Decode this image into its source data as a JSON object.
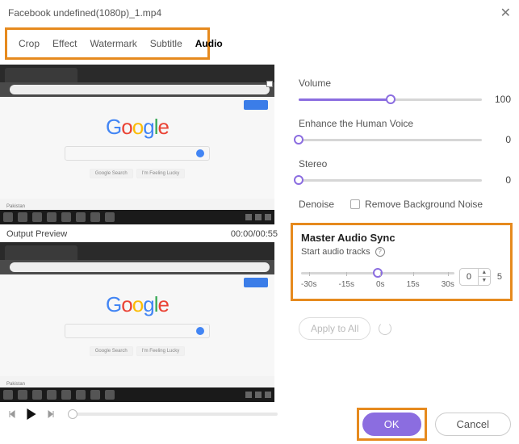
{
  "titlebar": {
    "filename": "Facebook undefined(1080p)_1.mp4"
  },
  "tabs": {
    "crop": "Crop",
    "effect": "Effect",
    "watermark": "Watermark",
    "subtitle": "Subtitle",
    "audio": "Audio",
    "active": "Audio"
  },
  "preview": {
    "output_label": "Output Preview",
    "timecode": "00:00/00:55",
    "google_btn1": "Google Search",
    "google_btn2": "I'm Feeling Lucky"
  },
  "audio": {
    "volume_label": "Volume",
    "volume_value": "100",
    "enhance_label": "Enhance the Human Voice",
    "enhance_value": "0",
    "stereo_label": "Stereo",
    "stereo_value": "0",
    "denoise_label": "Denoise",
    "remove_bg_label": "Remove Background Noise"
  },
  "sync": {
    "title": "Master Audio Sync",
    "subtitle": "Start audio tracks",
    "ticks": {
      "t0": "-30s",
      "t1": "-15s",
      "t2": "0s",
      "t3": "15s",
      "t4": "30s"
    },
    "stepper_value": "0",
    "range_max": "5"
  },
  "apply_all": "Apply to All",
  "footer": {
    "ok": "OK",
    "cancel": "Cancel"
  }
}
